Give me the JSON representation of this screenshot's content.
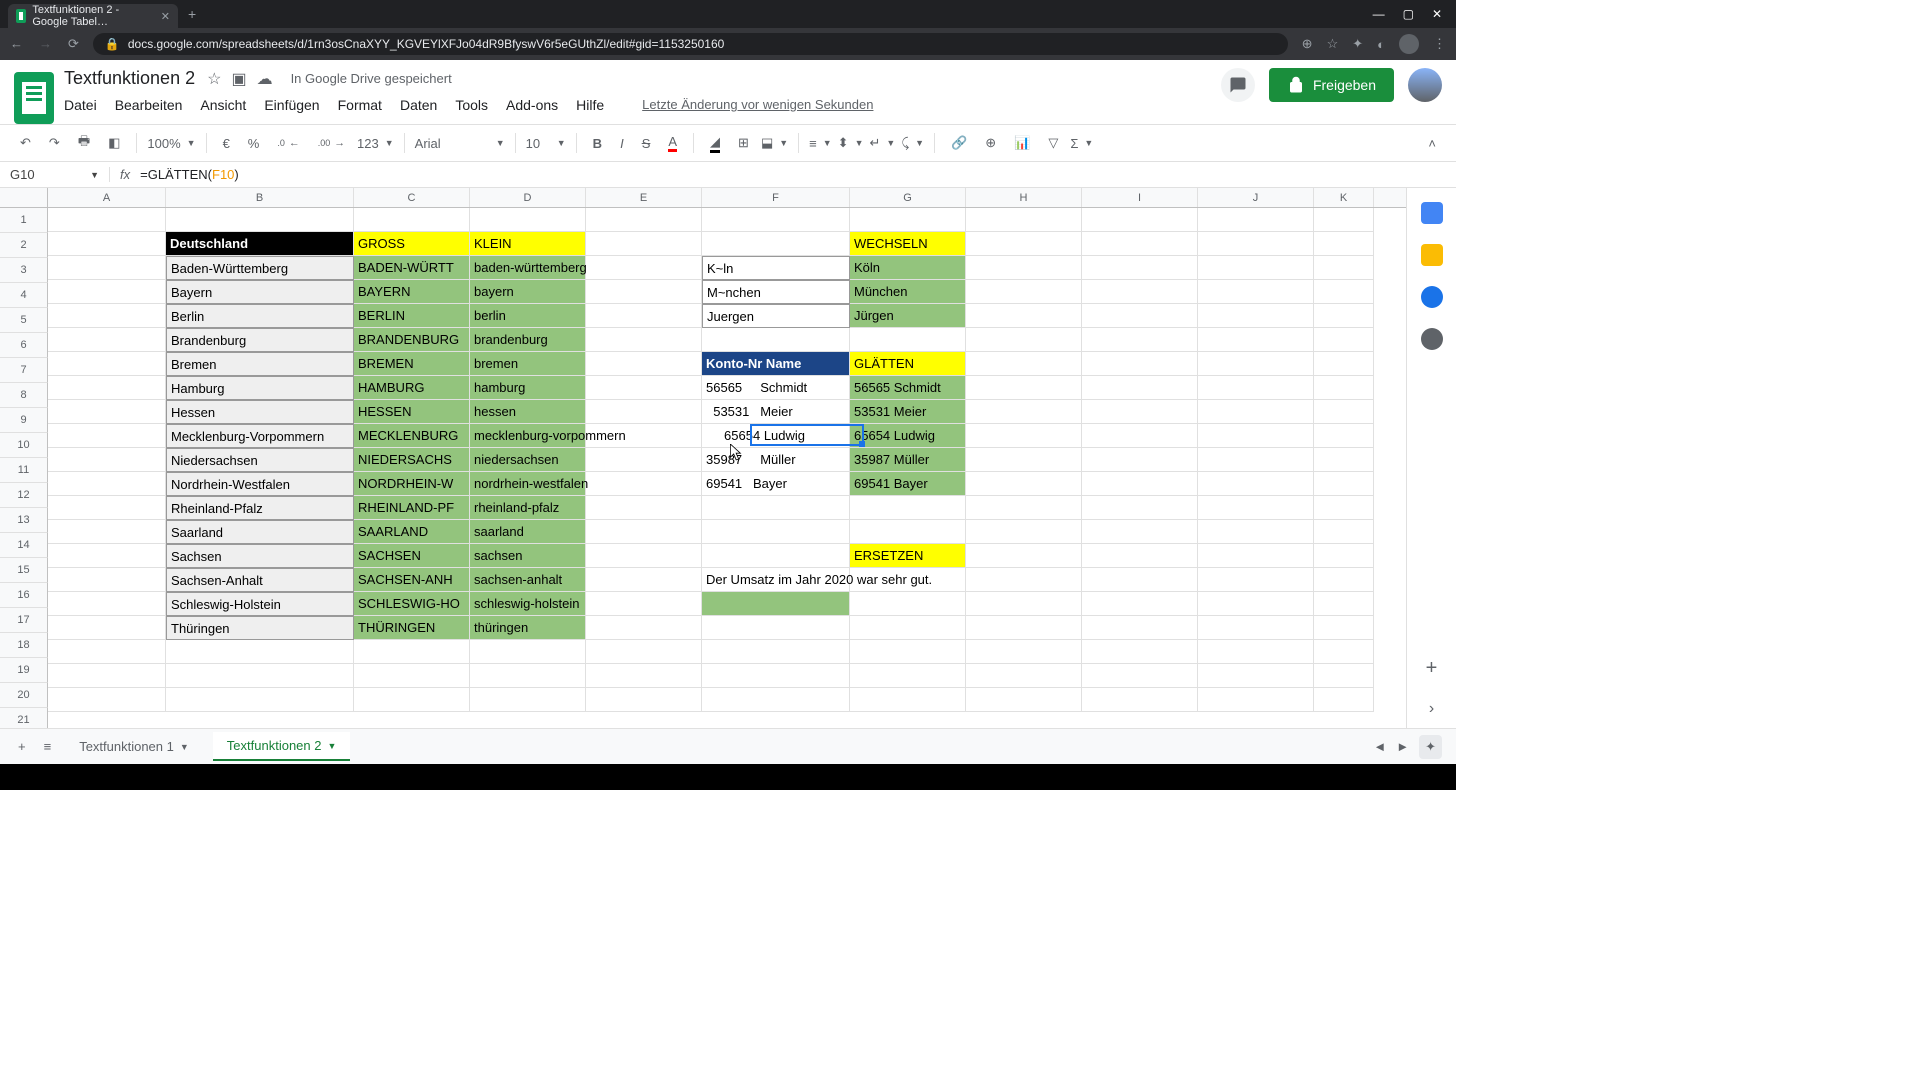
{
  "browser": {
    "tab_title": "Textfunktionen 2 - Google Tabel…",
    "url": "docs.google.com/spreadsheets/d/1rn3osCnaXYY_KGVEYlXFJo04dR9BfyswV6r5eGUthZl/edit#gid=1153250160"
  },
  "app": {
    "doc_title": "Textfunktionen 2",
    "save_status": "In Google Drive gespeichert",
    "last_edit": "Letzte Änderung vor wenigen Sekunden",
    "menus": [
      "Datei",
      "Bearbeiten",
      "Ansicht",
      "Einfügen",
      "Format",
      "Daten",
      "Tools",
      "Add-ons",
      "Hilfe"
    ],
    "share": "Freigeben"
  },
  "toolbar": {
    "zoom": "100%",
    "font": "Arial",
    "size": "10",
    "currency": "€",
    "percent": "%",
    "dec_dec": ".0",
    "inc_dec": ".00",
    "format": "123"
  },
  "formula": {
    "cell_ref": "G10",
    "prefix": "=GLÄTTEN(",
    "ref": "F10",
    "suffix": ")"
  },
  "columns": [
    "A",
    "B",
    "C",
    "D",
    "E",
    "F",
    "G",
    "H",
    "I",
    "J",
    "K"
  ],
  "rows": [
    1,
    2,
    3,
    4,
    5,
    6,
    7,
    8,
    9,
    10,
    11,
    12,
    13,
    14,
    15,
    16,
    17,
    18,
    19,
    20,
    21
  ],
  "data": {
    "B2": "Deutschland",
    "C2": "GROSS",
    "D2": "KLEIN",
    "G2": "WECHSELN",
    "B3": "Baden-Württemberg",
    "C3": "BADEN-WÜRTT",
    "D3": "baden-württemberg",
    "F3": "K~ln",
    "G3": "Köln",
    "B4": "Bayern",
    "C4": "BAYERN",
    "D4": "bayern",
    "F4": "M~nchen",
    "G4": "München",
    "B5": "Berlin",
    "C5": "BERLIN",
    "D5": "berlin",
    "F5": "Juergen",
    "G5": "Jürgen",
    "B6": "Brandenburg",
    "C6": "BRANDENBURG",
    "D6": "brandenburg",
    "B7": "Bremen",
    "C7": "BREMEN",
    "D7": "bremen",
    "F7": "Konto-Nr Name",
    "G7": "GLÄTTEN",
    "B8": "Hamburg",
    "C8": "HAMBURG",
    "D8": "hamburg",
    "F8": "56565     Schmidt",
    "G8": "56565 Schmidt",
    "B9": "Hessen",
    "C9": "HESSEN",
    "D9": "hessen",
    "F9": "  53531   Meier",
    "G9": "53531 Meier",
    "B10": "Mecklenburg-Vorpommern",
    "C10": "MECKLENBURG",
    "D10": "mecklenburg-vorpommern",
    "F10": "     65654 Ludwig",
    "G10": "65654 Ludwig",
    "B11": "Niedersachsen",
    "C11": "NIEDERSACHS",
    "D11": "niedersachsen",
    "F11": "35987     Müller",
    "G11": "35987 Müller",
    "B12": "Nordrhein-Westfalen",
    "C12": "NORDRHEIN-W",
    "D12": "nordrhein-westfalen",
    "F12": "69541   Bayer",
    "G12": "69541 Bayer",
    "B13": "Rheinland-Pfalz",
    "C13": "RHEINLAND-PF",
    "D13": "rheinland-pfalz",
    "B14": "Saarland",
    "C14": "SAARLAND",
    "D14": "saarland",
    "B15": "Sachsen",
    "C15": "SACHSEN",
    "D15": "sachsen",
    "G15": "ERSETZEN",
    "B16": "Sachsen-Anhalt",
    "C16": "SACHSEN-ANH",
    "D16": "sachsen-anhalt",
    "F16": "Der Umsatz im Jahr 2020 war sehr gut.",
    "B17": "Schleswig-Holstein",
    "C17": "SCHLESWIG-HO",
    "D17": "schleswig-holstein",
    "B18": "Thüringen",
    "C18": "THÜRINGEN",
    "D18": "thüringen"
  },
  "tabs": {
    "tab1": "Textfunktionen 1",
    "tab2": "Textfunktionen 2"
  }
}
